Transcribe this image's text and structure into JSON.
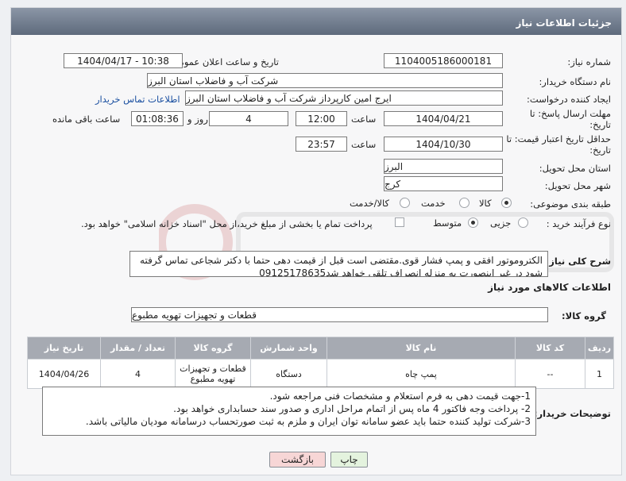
{
  "header": {
    "title": "جزئیات اطلاعات نیاز"
  },
  "fields": {
    "need_number_label": "شماره نیاز:",
    "need_number": "1104005186000181",
    "announce_label": "تاریخ و ساعت اعلان عمومی:",
    "announce_value": "1404/04/17 - 10:38",
    "buyer_label": "نام دستگاه خریدار:",
    "buyer_value": "شرکت آب و فاضلاب استان البرز",
    "creator_label": "ایجاد کننده درخواست:",
    "creator_value": "ایرج امین کارپرداز شرکت آب و فاضلاب استان البرز",
    "contact_link": "اطلاعات تماس خریدار",
    "deadline_label": "مهلت ارسال پاسخ: تا تاریخ:",
    "deadline_date": "1404/04/21",
    "time_label": "ساعت",
    "deadline_time": "12:00",
    "days_value": "4",
    "days_label": "روز و",
    "remaining_value": "01:08:36",
    "remaining_label": "ساعت باقی مانده",
    "validity_label": "حداقل تاریخ اعتبار قیمت: تا تاریخ:",
    "validity_date": "1404/10/30",
    "validity_time": "23:57",
    "province_label": "استان محل تحویل:",
    "province_value": "البرز",
    "city_label": "شهر محل تحویل:",
    "city_value": "کرج",
    "category_label": "طبقه بندی موضوعی:",
    "category_options": [
      "کالا",
      "خدمت",
      "کالا/خدمت"
    ],
    "purchase_label": "نوع فرآیند خرید :",
    "purchase_options": [
      "جزیی",
      "متوسط"
    ],
    "payment_note": "پرداخت تمام یا بخشی از مبلغ خرید،از محل \"اسناد خزانه اسلامی\" خواهد بود.",
    "desc_label": "شرح کلی نیاز:",
    "desc_value": "الکتروموتور افقی و پمپ فشار قوی.مقتضی است قبل از قیمت دهی حتما با دکتر شجاعی تماس گرفته شود در غیر اینصورت به منزله انصراف تلقی خواهد شد09125178635"
  },
  "goods": {
    "section_title": "اطلاعات کالاهای مورد نیاز",
    "group_label": "گروه کالا:",
    "group_value": "قطعات و تجهیزات تهویه مطبوع",
    "columns": [
      "ردیف",
      "کد کالا",
      "نام کالا",
      "واحد شمارش",
      "گروه کالا",
      "تعداد / مقدار",
      "تاریخ نیاز"
    ],
    "rows": [
      {
        "row": "1",
        "code": "--",
        "name": "پمپ چاه",
        "unit": "دستگاه",
        "group": "قطعات و تجهیزات تهویه مطبوع",
        "qty": "4",
        "date": "1404/04/26"
      }
    ]
  },
  "buyer_notes": {
    "label": "توضیحات خریدار:",
    "lines": [
      "1-جهت قیمت دهی به فرم استعلام و مشخصات فنی مراجعه شود.",
      "2- پرداخت وجه فاکتور 4 ماه پس از اتمام مراحل اداری و صدور سند حسابداری خواهد بود.",
      "3-شرکت تولید کننده حتما باید عضو سامانه توان ایران و ملزم به ثبت صورتحساب درسامانه مودیان مالیاتی باشد."
    ]
  },
  "buttons": {
    "print": "چاپ",
    "back": "بازگشت"
  },
  "colors": {
    "header": "#6c7788",
    "back_button": "#f7d6d6",
    "print_button": "#e4f3de"
  }
}
